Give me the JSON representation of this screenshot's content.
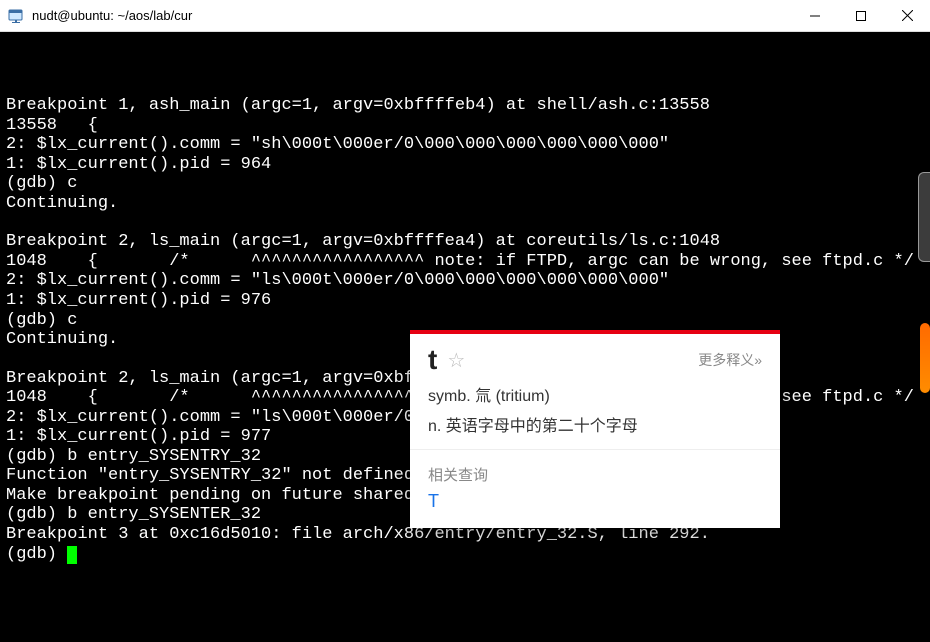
{
  "window": {
    "title": "nudt@ubuntu: ~/aos/lab/cur"
  },
  "terminal": {
    "lines": [
      "",
      "Breakpoint 1, ash_main (argc=1, argv=0xbffffeb4) at shell/ash.c:13558",
      "13558   {",
      "2: $lx_current().comm = \"sh\\000t\\000er/0\\000\\000\\000\\000\\000\\000\"",
      "1: $lx_current().pid = 964",
      "(gdb) c",
      "Continuing.",
      "",
      "Breakpoint 2, ls_main (argc=1, argv=0xbffffea4) at coreutils/ls.c:1048",
      "1048    {       /*      ^^^^^^^^^^^^^^^^^ note: if FTPD, argc can be wrong, see ftpd.c */",
      "2: $lx_current().comm = \"ls\\000t\\000er/0\\000\\000\\000\\000\\000\\000\"",
      "1: $lx_current().pid = 976",
      "(gdb) c",
      "Continuing.",
      "",
      "Breakpoint 2, ls_main (argc=1, argv=0xbffffea4) at coreutils/ls.c:1048",
      "1048    {       /*      ^^^^^^^^^^^^^^^^^ note: if FTPD, argc can be wrong, see ftpd.c */",
      "2: $lx_current().comm = \"ls\\000t\\000er/0\\000\\000\\000\\000\\000\\000\"",
      "1: $lx_current().pid = 977",
      "(gdb) b entry_SYSENTRY_32",
      "Function \"entry_SYSENTRY_32\" not defined.",
      "Make breakpoint pending on future shared library load? (y or [n]) n",
      "(gdb) b entry_SYSENTER_32",
      "Breakpoint 3 at 0xc16d5010: file arch/x86/entry/entry_32.S, line 292.",
      "(gdb) "
    ]
  },
  "dict": {
    "word": "t",
    "more_label": "更多释义»",
    "def1": "symb. 氚 (tritium)",
    "def2": "n. 英语字母中的第二十个字母",
    "related_title": "相关查询",
    "related_item": "T"
  }
}
